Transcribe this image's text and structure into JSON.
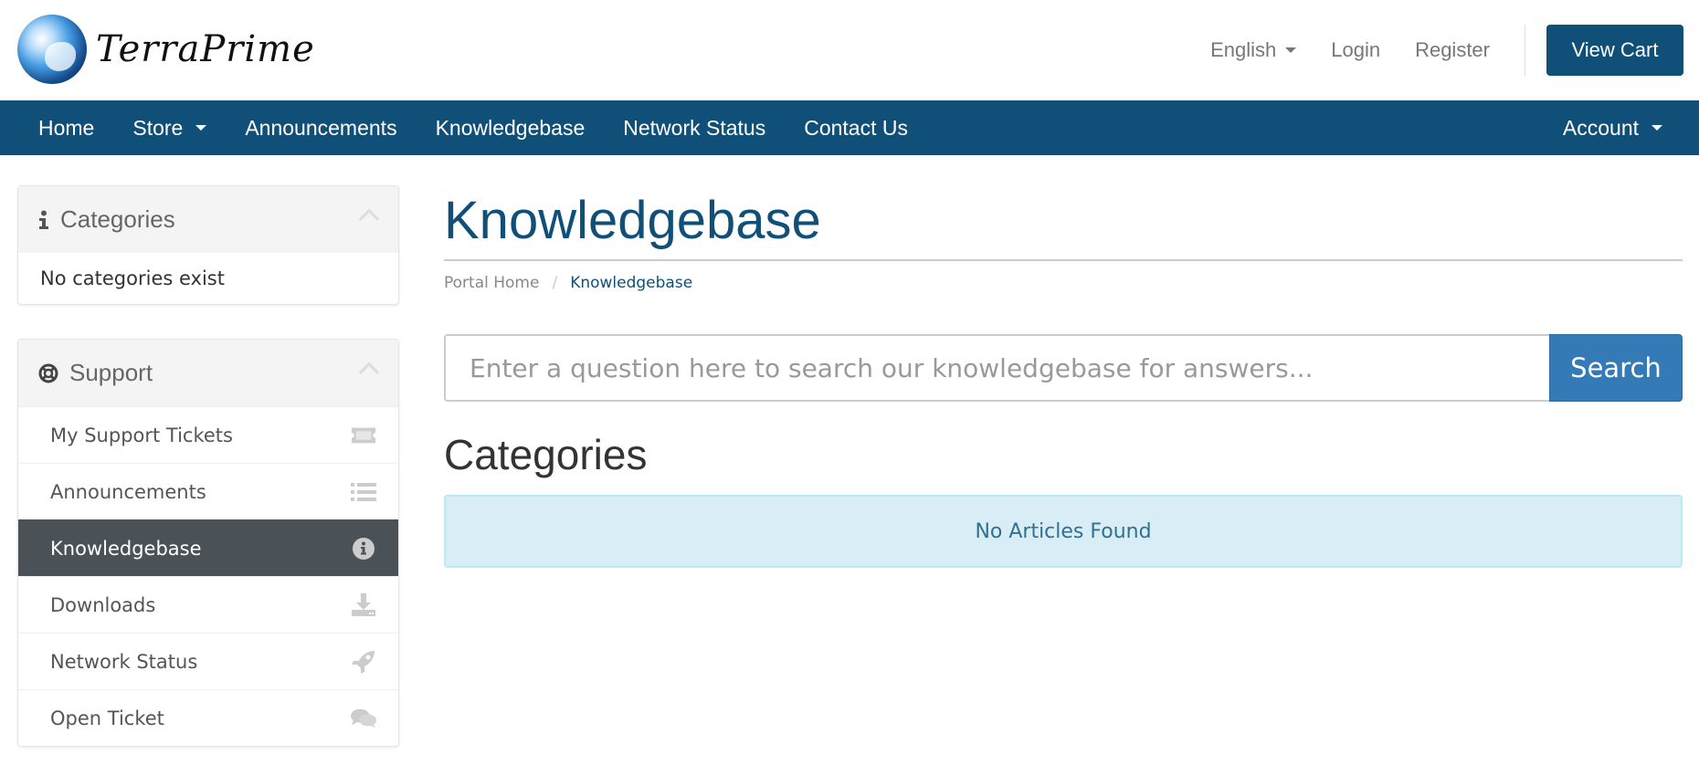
{
  "brand": {
    "name": "TerraPrime"
  },
  "header": {
    "language": "English",
    "login": "Login",
    "register": "Register",
    "view_cart": "View Cart"
  },
  "nav": {
    "items": [
      {
        "label": "Home"
      },
      {
        "label": "Store",
        "dropdown": true
      },
      {
        "label": "Announcements"
      },
      {
        "label": "Knowledgebase"
      },
      {
        "label": "Network Status"
      },
      {
        "label": "Contact Us"
      }
    ],
    "account": "Account"
  },
  "sidebar": {
    "categories": {
      "title": "Categories",
      "icon": "info-icon",
      "empty": "No categories exist"
    },
    "support": {
      "title": "Support",
      "icon": "life-ring-icon",
      "items": [
        {
          "label": "My Support Tickets",
          "icon": "ticket-icon"
        },
        {
          "label": "Announcements",
          "icon": "list-icon"
        },
        {
          "label": "Knowledgebase",
          "icon": "info-circle-icon",
          "active": true
        },
        {
          "label": "Downloads",
          "icon": "download-icon"
        },
        {
          "label": "Network Status",
          "icon": "rocket-icon"
        },
        {
          "label": "Open Ticket",
          "icon": "comments-icon"
        }
      ]
    }
  },
  "main": {
    "title": "Knowledgebase",
    "breadcrumb": {
      "home": "Portal Home",
      "separator": "/",
      "current": "Knowledgebase"
    },
    "search": {
      "placeholder": "Enter a question here to search our knowledgebase for answers...",
      "value": "",
      "button": "Search"
    },
    "section_title": "Categories",
    "alert": "No Articles Found"
  },
  "colors": {
    "brand": "#105078",
    "search_button": "#337ab7",
    "active_item": "#4a5157",
    "alert_bg": "#d9edf7",
    "alert_text": "#31708f"
  }
}
